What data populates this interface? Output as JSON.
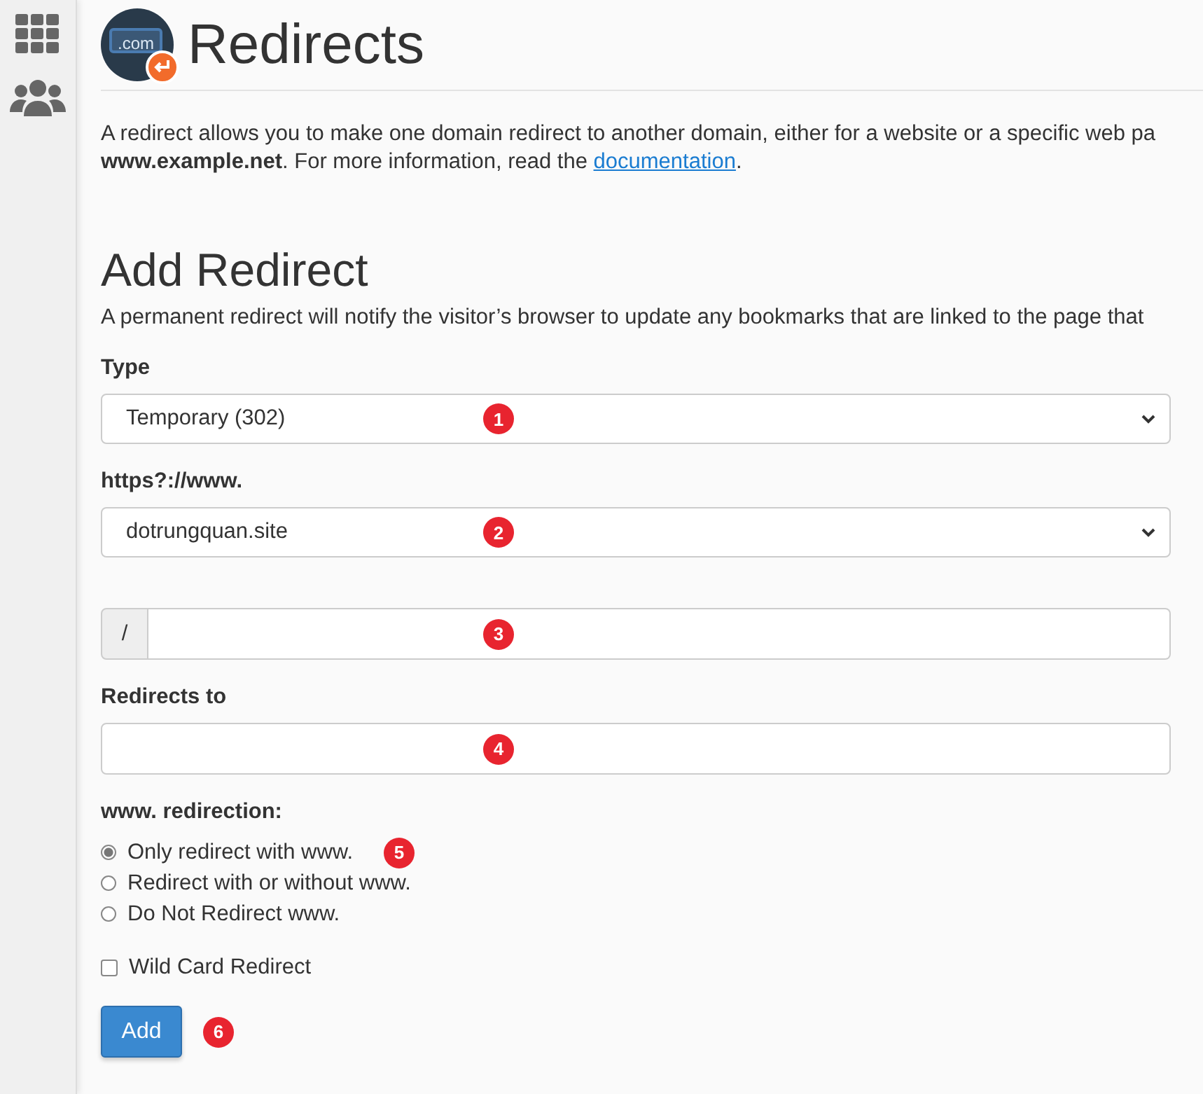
{
  "header": {
    "logo_text": ".com",
    "title": "Redirects"
  },
  "intro": {
    "line_1": "A redirect allows you to make one domain redirect to another domain, either for a website or a specific web pa",
    "line_2": "**www.example.net**. For more information, read the ",
    "link": "documentation",
    "after_link": "."
  },
  "section": {
    "title": "Add Redirect",
    "description": "A permanent redirect will notify the visitor’s browser to update any bookmarks that are linked to the page that"
  },
  "fields": [
    {
      "kind": "select",
      "label": "Type",
      "value": "Temporary (302)",
      "marker": "1"
    },
    {
      "kind": "select",
      "label": "https?://www.",
      "value": "dotrungquan.site",
      "marker": "2"
    },
    {
      "kind": "prefixed_input",
      "prefix": "/",
      "marker": "3"
    },
    {
      "kind": "input",
      "label": "Redirects to",
      "marker": "4"
    }
  ],
  "redirection": {
    "label": "www. redirection:",
    "marker": "5",
    "options": [
      {
        "label": "Only redirect with www.",
        "selected": true
      },
      {
        "label": "Redirect with or without www.",
        "selected": false
      },
      {
        "label": "Do Not Redirect www.",
        "selected": false
      }
    ]
  },
  "wildcard": {
    "label": "Wild Card Redirect",
    "checked": false
  },
  "add_button": {
    "label": "Add",
    "marker": "6"
  }
}
